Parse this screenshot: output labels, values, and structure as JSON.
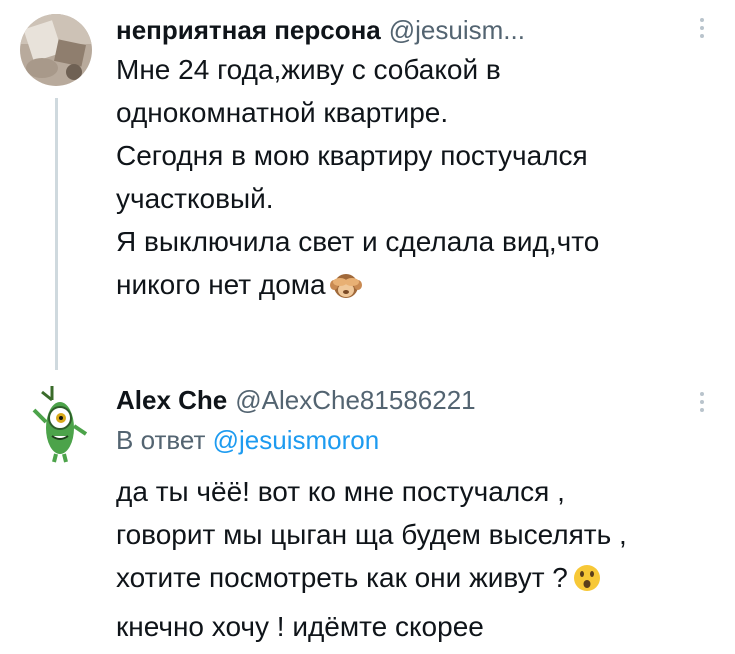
{
  "tweets": [
    {
      "display_name": "неприятная персона",
      "handle": "@jesuism...",
      "lines": [
        "Мне 24 года,живу с собакой в",
        "однокомнатной квартире.",
        "Сегодня в мою квартиру постучался",
        "участковый.",
        "Я выключила свет и сделала вид,что",
        "никого нет дома"
      ],
      "emoji": "see-no-evil-monkey"
    },
    {
      "display_name": "Alex Che",
      "handle": "@AlexChe81586221",
      "reply_prefix": "В ответ",
      "reply_mention": "@jesuismoron",
      "lines": [
        "да ты чёё! вот ко мне постучался ,",
        "говорит мы цыган ща будем выселять ,",
        "хотите посмотреть как они живут ?",
        "кнечно хочу ! идёмте скорее"
      ],
      "emoji": "face-with-open-mouth"
    }
  ],
  "colors": {
    "text": "#0f1419",
    "secondary": "#536471",
    "link": "#1d9bf0",
    "thread_line": "#cfd9de"
  }
}
